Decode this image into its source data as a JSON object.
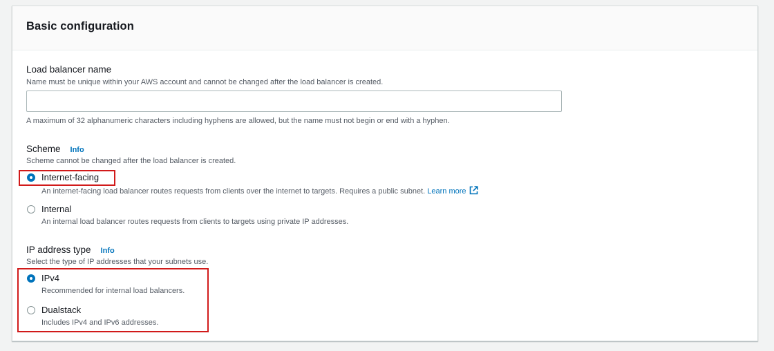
{
  "section": {
    "title": "Basic configuration"
  },
  "name_field": {
    "label": "Load balancer name",
    "description": "Name must be unique within your AWS account and cannot be changed after the load balancer is created.",
    "value": "",
    "placeholder": "",
    "hint": "A maximum of 32 alphanumeric characters including hyphens are allowed, but the name must not begin or end with a hyphen."
  },
  "scheme": {
    "label": "Scheme",
    "info": "Info",
    "description": "Scheme cannot be changed after the load balancer is created.",
    "selected": "Internet-facing",
    "options": [
      {
        "label": "Internet-facing",
        "description": "An internet-facing load balancer routes requests from clients over the internet to targets. Requires a public subnet.",
        "link": "Learn more"
      },
      {
        "label": "Internal",
        "description": "An internal load balancer routes requests from clients to targets using private IP addresses."
      }
    ]
  },
  "ip_type": {
    "label": "IP address type",
    "info": "Info",
    "description": "Select the type of IP addresses that your subnets use.",
    "selected": "IPv4",
    "options": [
      {
        "label": "IPv4",
        "description": "Recommended for internal load balancers."
      },
      {
        "label": "Dualstack",
        "description": "Includes IPv4 and IPv6 addresses."
      }
    ]
  },
  "colors": {
    "accent": "#0073bb",
    "highlight": "#d11a1a"
  },
  "icons": {
    "external_link": "external-link-icon"
  }
}
